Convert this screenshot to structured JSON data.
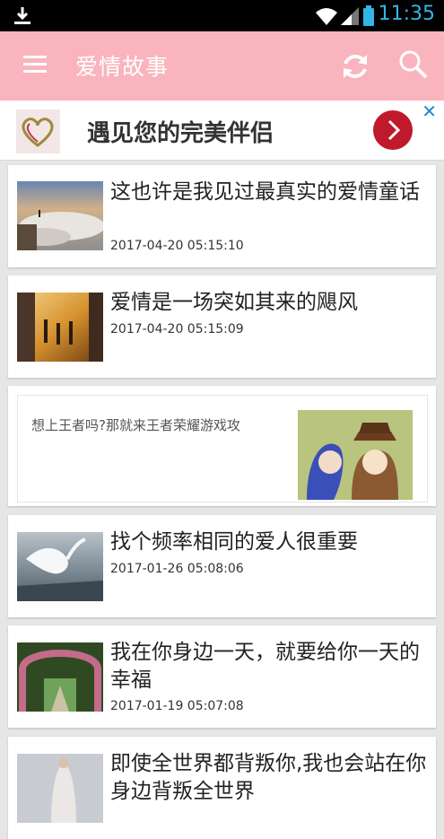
{
  "status_bar": {
    "time": "11:35"
  },
  "app_bar": {
    "title": "爱情故事"
  },
  "ad_banner": {
    "text": "遇见您的完美伴侣",
    "close": "✕"
  },
  "articles": [
    {
      "title": "这也许是我见过最真实的爱情童话",
      "date": "2017-04-20 05:15:10"
    },
    {
      "title": "爱情是一场突如其来的飓风",
      "date": "2017-04-20 05:15:09"
    },
    {
      "title": "找个频率相同的爱人很重要",
      "date": "2017-01-26 05:08:06"
    },
    {
      "title": "我在你身边一天，就要给你一天的幸福",
      "date": "2017-01-19 05:07:08"
    },
    {
      "title": "即使全世界都背叛你,我也会站在你身边背叛全世界",
      "date": ""
    }
  ],
  "ad_card": {
    "text": "想上王者吗?那就来王者荣耀游戏攻"
  },
  "colors": {
    "app_bar": "#f9b4bd",
    "time": "#33b5e5",
    "ad_button": "#c0192c"
  }
}
